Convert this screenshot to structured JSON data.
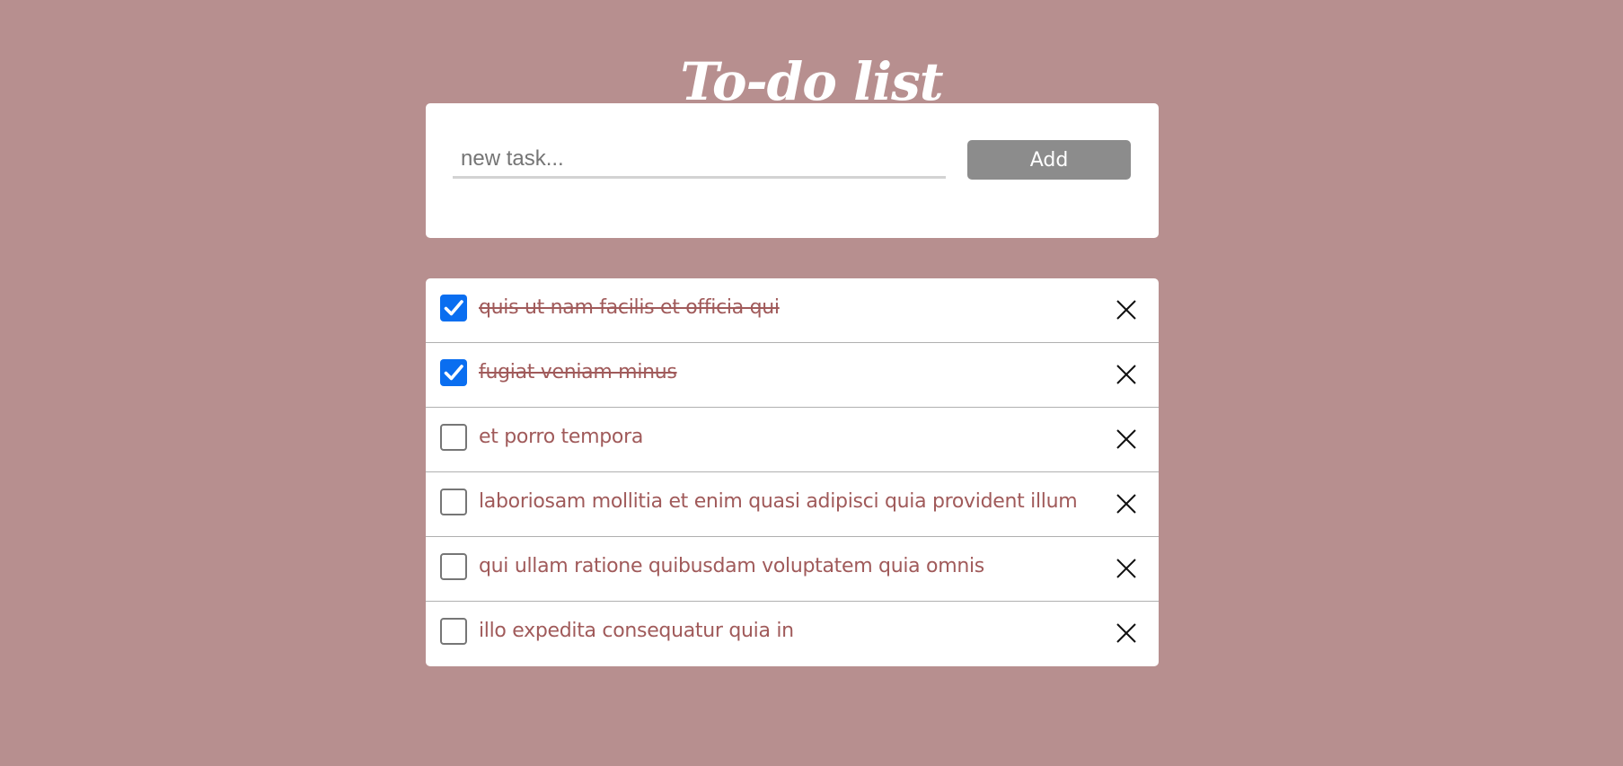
{
  "app": {
    "title": "To-do list"
  },
  "new_task": {
    "placeholder": "new task...",
    "value": "",
    "add_label": "Add"
  },
  "tasks": [
    {
      "text": "quis ut nam facilis et officia qui",
      "completed": true
    },
    {
      "text": "fugiat veniam minus",
      "completed": true
    },
    {
      "text": "et porro tempora",
      "completed": false
    },
    {
      "text": "laboriosam mollitia et enim quasi adipisci quia provident illum",
      "completed": false
    },
    {
      "text": "qui ullam ratione quibusdam voluptatem quia omnis",
      "completed": false
    },
    {
      "text": "illo expedita consequatur quia in",
      "completed": false
    }
  ],
  "icons": {
    "checkbox_checked": "check-icon",
    "delete": "close-icon"
  },
  "colors": {
    "background": "#b78f8f",
    "card": "#ffffff",
    "task_text": "#a05a5a",
    "checkbox_checked": "#0a6ef0",
    "add_button": "#8c8c8c",
    "title": "#ffffff"
  }
}
